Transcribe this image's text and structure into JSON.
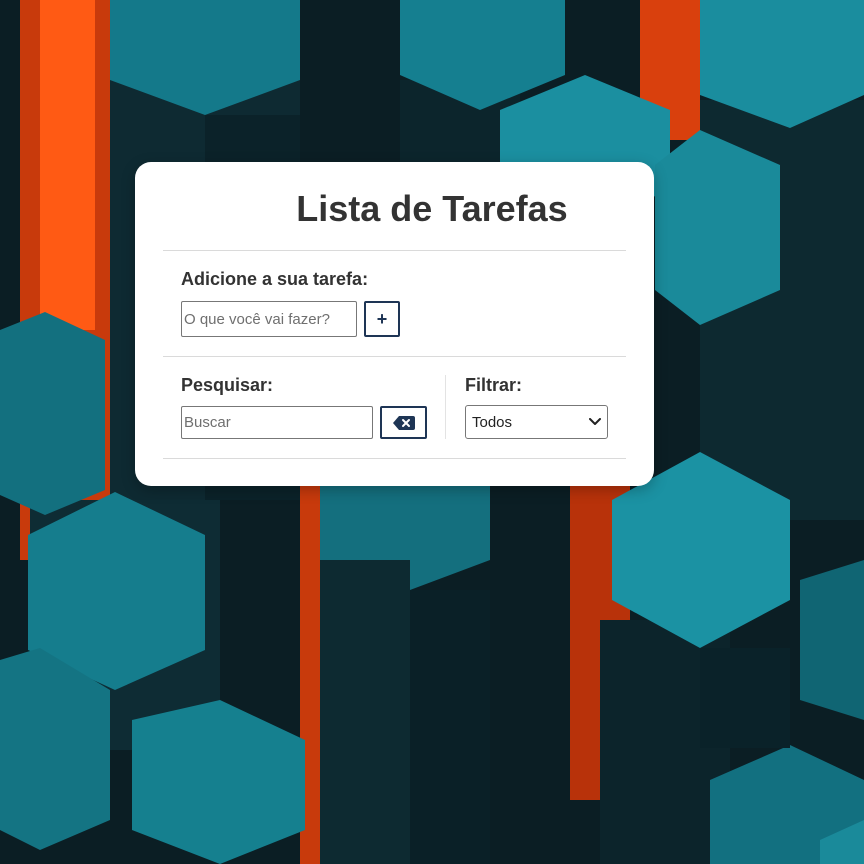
{
  "app": {
    "title": "Lista de Tarefas"
  },
  "add_section": {
    "label": "Adicione a sua tarefa:",
    "input_placeholder": "O que você vai fazer?",
    "input_value": "",
    "button_label": "+"
  },
  "search_section": {
    "label": "Pesquisar:",
    "input_placeholder": "Buscar",
    "input_value": "",
    "clear_icon": "backspace-icon"
  },
  "filter_section": {
    "label": "Filtrar:",
    "selected": "Todos",
    "dropdown_icon": "chevron-down-icon"
  },
  "colors": {
    "button_border": "#1e3555",
    "title_text": "#333333",
    "card_background": "#ffffff",
    "background_teal": "#1a8a9a",
    "background_orange": "#e0460f"
  }
}
